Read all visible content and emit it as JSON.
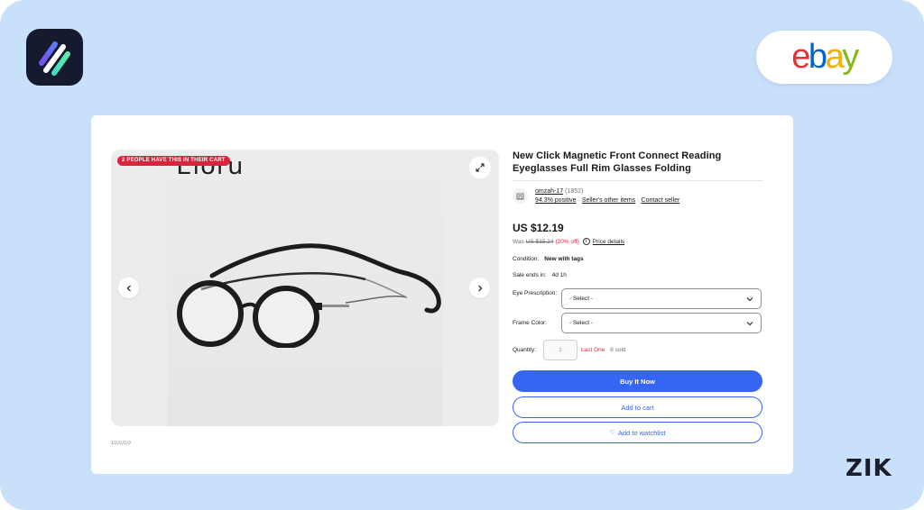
{
  "brand": {
    "ebay_letters": [
      {
        "ch": "e",
        "color": "#e53238"
      },
      {
        "ch": "b",
        "color": "#0064d2"
      },
      {
        "ch": "a",
        "color": "#f5af02"
      },
      {
        "ch": "y",
        "color": "#86b817"
      }
    ],
    "zik": "ZIK"
  },
  "gallery": {
    "cart_badge": "2 PEOPLE HAVE THIS IN THEIR CART",
    "brand_text": "Eloru",
    "caption": "10,0,0,0"
  },
  "listing": {
    "title": "New Click Magnetic Front Connect Reading Eyeglasses Full Rim Glasses Folding",
    "seller": {
      "username": "omzah-17",
      "feedback_count": "(1852)",
      "positive": "94.3% positive",
      "other_items": "Seller's other items",
      "contact": "Contact seller"
    },
    "price": "US $12.19",
    "was": {
      "label": "Was",
      "old_price": "US $15.24",
      "discount": "(20% off)",
      "price_details": "Price details"
    },
    "condition": {
      "label": "Condition:",
      "value": "New with tags"
    },
    "sale_ends": {
      "label": "Sale ends in:",
      "value": "4d 1h"
    },
    "options": {
      "eye_label": "Eye Prescription:",
      "eye_value": "- Select -",
      "frame_label": "Frame Color:",
      "frame_value": "- Select -"
    },
    "quantity": {
      "label": "Quantity:",
      "value": "1",
      "last_one": "Last One",
      "sold": " · 8 sold"
    },
    "buttons": {
      "buy": "Buy It Now",
      "cart": "Add to cart",
      "watch": "Add to watchlist"
    }
  },
  "colors": {
    "background": "#c9e0fb",
    "accent": "#3665f3",
    "discount": "#e0253f"
  }
}
